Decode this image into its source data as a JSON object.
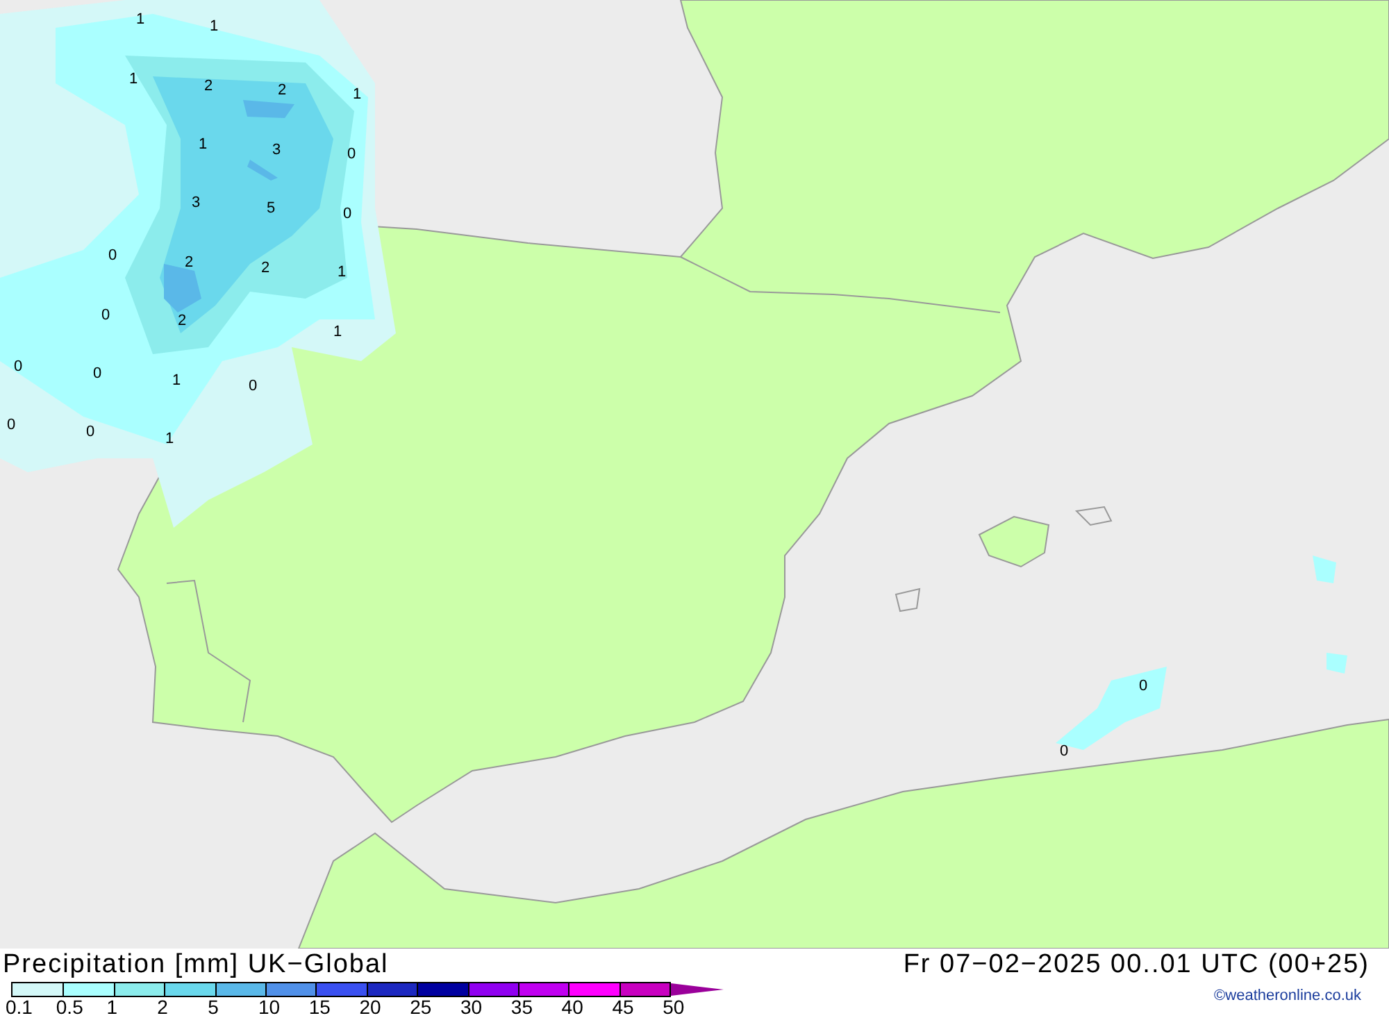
{
  "map": {
    "labels": [
      "1",
      "1",
      "1",
      "2",
      "2",
      "1",
      "1",
      "3",
      "0",
      "3",
      "5",
      "0",
      "0",
      "2",
      "2",
      "1",
      "0",
      "2",
      "1",
      "0",
      "0",
      "1",
      "0",
      "0",
      "0",
      "1",
      "0",
      "0"
    ]
  },
  "title": "Precipitation [mm] UK−Global",
  "valid_time": "Fr 07−02−2025 00..01 UTC (00+25)",
  "legend": {
    "segments": [
      {
        "color": "#d4f8f8"
      },
      {
        "color": "#aaffff"
      },
      {
        "color": "#8cecec"
      },
      {
        "color": "#6ad8ec"
      },
      {
        "color": "#5ab8e8"
      },
      {
        "color": "#5090e8"
      },
      {
        "color": "#3a50f0"
      },
      {
        "color": "#1c28c0"
      },
      {
        "color": "#0000a0"
      },
      {
        "color": "#9000f0"
      },
      {
        "color": "#c000f0"
      },
      {
        "color": "#ff00ff"
      },
      {
        "color": "#c800c0"
      },
      {
        "kind": "arrow",
        "color": "#9a009a"
      }
    ],
    "ticks": [
      "0.1",
      "0.5",
      "1",
      "2",
      "5",
      "10",
      "15",
      "20",
      "25",
      "30",
      "35",
      "40",
      "45",
      "50"
    ]
  },
  "copyright": "©weatheronline.co.uk"
}
